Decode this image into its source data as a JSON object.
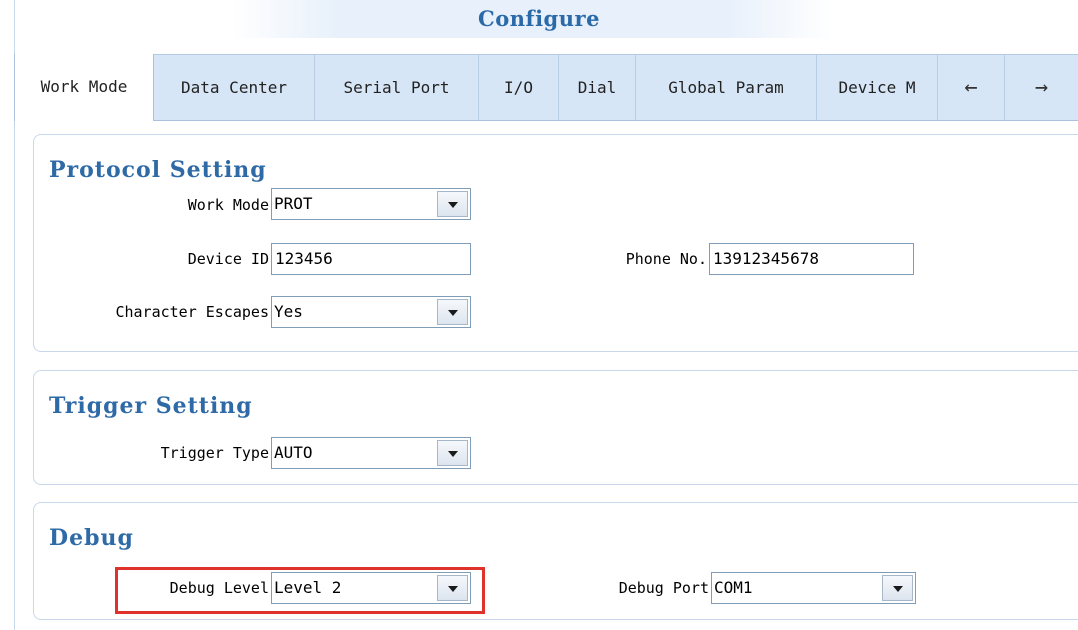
{
  "window": {
    "title": "Configure"
  },
  "tabs": [
    {
      "label": "Work Mode",
      "active": true
    },
    {
      "label": "Data Center"
    },
    {
      "label": "Serial Port"
    },
    {
      "label": "I/O"
    },
    {
      "label": "Dial"
    },
    {
      "label": "Global Param"
    },
    {
      "label": "Device M"
    }
  ],
  "tab_nav": {
    "prev_icon": "arrow-left-icon",
    "prev_glyph": "←",
    "next_icon": "arrow-right-icon",
    "next_glyph": "→"
  },
  "protocol": {
    "title": "Protocol Setting",
    "work_mode_label": "Work Mode",
    "work_mode_value": "PROT",
    "device_id_label": "Device ID",
    "device_id_value": "123456",
    "phone_label": "Phone No.",
    "phone_value": "13912345678",
    "escapes_label": "Character Escapes",
    "escapes_value": "Yes"
  },
  "trigger": {
    "title": "Trigger Setting",
    "type_label": "Trigger Type",
    "type_value": "AUTO"
  },
  "debug": {
    "title": "Debug",
    "level_label": "Debug Level",
    "level_value": "Level 2",
    "port_label": "Debug Port",
    "port_value": "COM1"
  },
  "colors": {
    "accent": "#2e6aa6",
    "tab_bar": "#d7e6f6",
    "highlight": "#e0322c"
  }
}
